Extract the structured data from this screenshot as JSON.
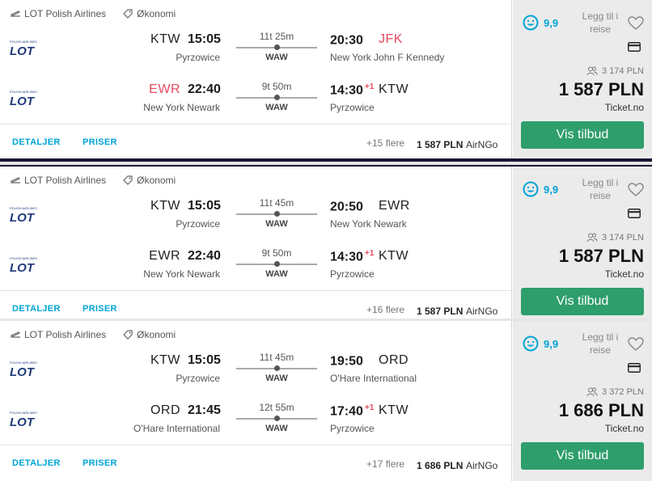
{
  "results": [
    {
      "airline": "LOT Polish Airlines",
      "cabin": "Økonomi",
      "logo_text": "LOT",
      "legs": [
        {
          "dep_code": "KTW",
          "dep_time": "15:05",
          "dep_name": "Pyrzowice",
          "duration": "11t 25m",
          "stop": "WAW",
          "arr_time": "20:30",
          "arr_plus": "",
          "arr_code": "JFK",
          "arr_name": "New York John F Kennedy"
        },
        {
          "dep_code": "EWR",
          "dep_time": "22:40",
          "dep_name": "New York Newark",
          "duration": "9t 50m",
          "stop": "WAW",
          "arr_time": "14:30",
          "arr_plus": "+1",
          "arr_code": "KTW",
          "arr_name": "Pyrzowice"
        }
      ],
      "details_label": "DETALJER",
      "prices_label": "PRISER",
      "more": "+15 flere",
      "bottom_price": "1 587 PLN",
      "bottom_provider": "AirNGo",
      "score": "9,9",
      "trip_label": "Legg til i reise",
      "people_price": "3 174 PLN",
      "price": "1 587 PLN",
      "provider": "Ticket.no",
      "button": "Vis tilbud"
    },
    {
      "airline": "LOT Polish Airlines",
      "cabin": "Økonomi",
      "logo_text": "LOT",
      "legs": [
        {
          "dep_code": "KTW",
          "dep_time": "15:05",
          "dep_name": "Pyrzowice",
          "duration": "11t 45m",
          "stop": "WAW",
          "arr_time": "20:50",
          "arr_plus": "",
          "arr_code": "EWR",
          "arr_name": "New York Newark"
        },
        {
          "dep_code": "EWR",
          "dep_time": "22:40",
          "dep_name": "New York Newark",
          "duration": "9t 50m",
          "stop": "WAW",
          "arr_time": "14:30",
          "arr_plus": "+1",
          "arr_code": "KTW",
          "arr_name": "Pyrzowice"
        }
      ],
      "details_label": "DETALJER",
      "prices_label": "PRISER",
      "more": "+16 flere",
      "bottom_price": "1 587 PLN",
      "bottom_provider": "AirNGo",
      "score": "9,9",
      "trip_label": "Legg til i reise",
      "people_price": "3 174 PLN",
      "price": "1 587 PLN",
      "provider": "Ticket.no",
      "button": "Vis tilbud"
    },
    {
      "airline": "LOT Polish Airlines",
      "cabin": "Økonomi",
      "logo_text": "LOT",
      "legs": [
        {
          "dep_code": "KTW",
          "dep_time": "15:05",
          "dep_name": "Pyrzowice",
          "duration": "11t 45m",
          "stop": "WAW",
          "arr_time": "19:50",
          "arr_plus": "",
          "arr_code": "ORD",
          "arr_name": "O'Hare International"
        },
        {
          "dep_code": "ORD",
          "dep_time": "21:45",
          "dep_name": "O'Hare International",
          "duration": "12t 55m",
          "stop": "WAW",
          "arr_time": "17:40",
          "arr_plus": "+1",
          "arr_code": "KTW",
          "arr_name": "Pyrzowice"
        }
      ],
      "details_label": "DETALJER",
      "prices_label": "PRISER",
      "more": "+17 flere",
      "bottom_price": "1 686 PLN",
      "bottom_provider": "AirNGo",
      "score": "9,9",
      "trip_label": "Legg til i reise",
      "people_price": "3 372 PLN",
      "price": "1 686 PLN",
      "provider": "Ticket.no",
      "button": "Vis tilbud"
    }
  ],
  "colors": {
    "accent_blue": "#00a4d6",
    "highlight_red": "#e84a5f",
    "button_green": "#2e9e6c",
    "logo_navy": "#1f3a7a"
  }
}
